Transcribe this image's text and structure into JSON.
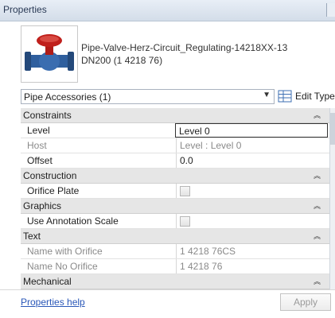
{
  "window": {
    "title": "Properties"
  },
  "type_preview": {
    "name_line1": "Pipe-Valve-Herz-Circuit_Regulating-14218XX-13",
    "name_line2": "DN200 (1 4218 76)"
  },
  "selector": {
    "value": "Pipe Accessories (1)",
    "edit_type_label": "Edit Type"
  },
  "groups": {
    "constraints": "Constraints",
    "construction": "Construction",
    "graphics": "Graphics",
    "text": "Text",
    "mechanical": "Mechanical"
  },
  "properties": {
    "level": {
      "label": "Level",
      "value": "Level 0"
    },
    "host": {
      "label": "Host",
      "value": "Level : Level 0"
    },
    "offset": {
      "label": "Offset",
      "value": "0.0"
    },
    "orifice_plate": {
      "label": "Orifice Plate",
      "checked": false
    },
    "use_annotation_scale": {
      "label": "Use Annotation Scale",
      "checked": false
    },
    "name_with_orifice": {
      "label": "Name with Orifice",
      "value": "1 4218 76CS"
    },
    "name_no_orifice": {
      "label": "Name No Orifice",
      "value": "1 4218 76"
    }
  },
  "footer": {
    "help_link": "Properties help",
    "apply_label": "Apply"
  },
  "icons": {
    "collapse": "double-chevron-up-icon",
    "edit_type": "edit-type-icon",
    "dropdown": "chevron-down-icon"
  },
  "colors": {
    "valve_red": "#c0201c",
    "valve_blue": "#2f5f9e",
    "link": "#2a57b8"
  }
}
